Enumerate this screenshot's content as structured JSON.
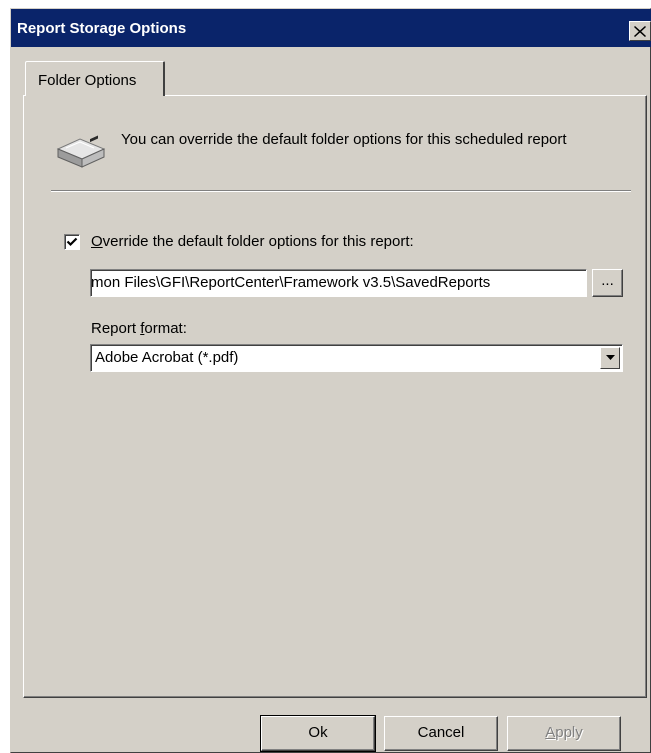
{
  "window": {
    "title": "Report Storage Options",
    "close_label": "×"
  },
  "tabs": [
    {
      "label": "Folder Options",
      "selected": true
    }
  ],
  "folder_options": {
    "info_text": "You can override the default folder options for this scheduled report",
    "override_checkbox": {
      "checked": true,
      "label": "Override the default folder options for this report:"
    },
    "path_value": "mon Files\\GFI\\ReportCenter\\Framework v3.5\\SavedReports",
    "browse_label": "...",
    "format_label_pre": "Report ",
    "format_label_underlined": "f",
    "format_label_post": "ormat:",
    "format_value": "Adobe Acrobat (*.pdf)"
  },
  "buttons": {
    "ok": "Ok",
    "cancel": "Cancel",
    "apply_underlined": "A",
    "apply_rest": "pply"
  },
  "colors": {
    "titlebar": "#0a246a",
    "face": "#d4d0c8",
    "disabled_text": "#808080"
  },
  "icons": {
    "drive": "hard-drive-icon",
    "check": "checkmark-icon",
    "dropdown": "chevron-down-icon",
    "close": "close-icon"
  }
}
